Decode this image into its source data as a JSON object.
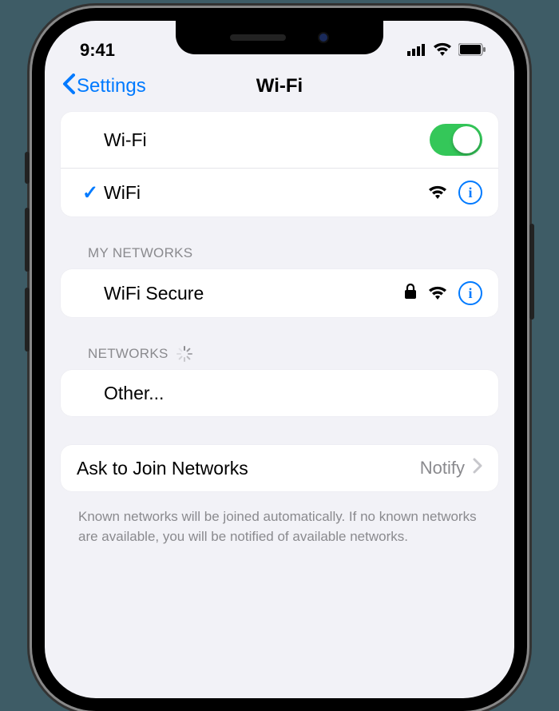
{
  "status": {
    "time": "9:41"
  },
  "nav": {
    "back": "Settings",
    "title": "Wi-Fi"
  },
  "wifi": {
    "label": "Wi-Fi",
    "enabled": true,
    "connected_network": "WiFi"
  },
  "sections": {
    "my_networks_header": "My Networks",
    "networks_header": "Networks",
    "my_networks": [
      {
        "name": "WiFi Secure",
        "secure": true
      }
    ],
    "other": "Other..."
  },
  "ask_join": {
    "label": "Ask to Join Networks",
    "value": "Notify"
  },
  "footer": "Known networks will be joined automatically. If no known networks are available, you will be notified of available networks."
}
